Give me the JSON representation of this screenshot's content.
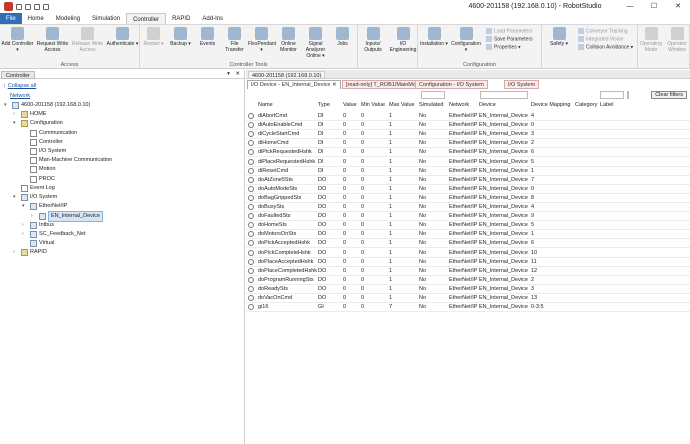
{
  "window": {
    "title": "4600-201158 (192.168.0.10) - RobotStudio",
    "minimize": "—",
    "maximize": "☐",
    "close": "✕"
  },
  "menu": [
    "File",
    "Home",
    "Modeling",
    "Simulation",
    "Controller",
    "RAPID",
    "Add-Ins"
  ],
  "ribbon": {
    "groups": [
      {
        "label": "Access",
        "buttons": [
          "Add Controller ▾",
          "Request Write Access",
          "Release Write Access",
          "Authenticate ▾"
        ]
      },
      {
        "label": "Controller Tools",
        "buttons": [
          "Restart ▾",
          "Backup ▾",
          "Events",
          "File Transfer",
          "FlexPendant ▾",
          "Online Monitor",
          "Signal Analyzer Online ▾",
          "Jobs"
        ]
      },
      {
        "label": "",
        "buttons": [
          "Inputs/ Outputs",
          "I/O Engineering"
        ]
      },
      {
        "label": "Configuration",
        "buttons": [
          "Installation ▾",
          "Configuration ▾"
        ],
        "small": [
          "Load Parameters",
          "Save Parameters",
          "Properties ▾"
        ]
      },
      {
        "label": "",
        "buttons": [
          "Safety ▾"
        ],
        "small": [
          "Conveyor Tracking",
          "Integrated Vision",
          "Collision Avoidance ▾"
        ]
      },
      {
        "label": "",
        "buttons": [
          "Operating Mode",
          "Operator Window"
        ]
      }
    ]
  },
  "controller_panel": {
    "tab": "Controller",
    "collapse": "Collapse all",
    "network": "Network",
    "tree": [
      {
        "label": "4600-201158 (192.168.0.10)",
        "level": 0,
        "exp": "▾",
        "icon": "controller"
      },
      {
        "label": "HOME",
        "level": 1,
        "exp": "›",
        "icon": "folder"
      },
      {
        "label": "Configuration",
        "level": 1,
        "exp": "▾",
        "icon": "folder"
      },
      {
        "label": "Communication",
        "level": 2,
        "exp": "",
        "icon": "doc"
      },
      {
        "label": "Controller",
        "level": 2,
        "exp": "",
        "icon": "doc"
      },
      {
        "label": "I/O System",
        "level": 2,
        "exp": "",
        "icon": "doc"
      },
      {
        "label": "Man-Machine Communication",
        "level": 2,
        "exp": "",
        "icon": "doc"
      },
      {
        "label": "Motion",
        "level": 2,
        "exp": "",
        "icon": "doc"
      },
      {
        "label": "PROC",
        "level": 2,
        "exp": "",
        "icon": "doc"
      },
      {
        "label": "Event Log",
        "level": 1,
        "exp": "",
        "icon": "doc"
      },
      {
        "label": "I/O System",
        "level": 1,
        "exp": "▾",
        "icon": "dev"
      },
      {
        "label": "EtherNet/IP",
        "level": 2,
        "exp": "▾",
        "icon": "dev"
      },
      {
        "label": "EN_Internal_Device",
        "level": 3,
        "exp": "›",
        "icon": "dev",
        "selected": true
      },
      {
        "label": "Intbus",
        "level": 2,
        "exp": "›",
        "icon": "dev"
      },
      {
        "label": "SC_Feedback_Net",
        "level": 2,
        "exp": "›",
        "icon": "dev"
      },
      {
        "label": "Virtual",
        "level": 2,
        "exp": "",
        "icon": "dev"
      },
      {
        "label": "RAPID",
        "level": 1,
        "exp": "›",
        "icon": "folder"
      }
    ]
  },
  "doc": {
    "tab": "4600-201158 (192.168.0.10)",
    "subtabs": [
      "I/O Device - EN_Internal_Device ✕",
      "[read-only] T_ROB1/MainModule",
      "Configuration - I/O System",
      "I/O System"
    ],
    "clear_filters": "Clear filters",
    "columns": [
      "Name",
      "Type",
      "Value",
      "Min Value",
      "Max Value",
      "Simulated",
      "Network",
      "Device",
      "Device Mapping",
      "Category",
      "Label"
    ],
    "rows": [
      [
        "diAbortCmd",
        "DI",
        "0",
        "0",
        "1",
        "No",
        "EtherNet/IP",
        "EN_Internal_Device",
        "4",
        "",
        ""
      ],
      [
        "diAutoEnableCmd",
        "DI",
        "0",
        "0",
        "1",
        "No",
        "EtherNet/IP",
        "EN_Internal_Device",
        "0",
        "",
        ""
      ],
      [
        "diCycleStartCmd",
        "DI",
        "0",
        "0",
        "1",
        "No",
        "EtherNet/IP",
        "EN_Internal_Device",
        "3",
        "",
        ""
      ],
      [
        "diHomeCmd",
        "DI",
        "0",
        "0",
        "1",
        "No",
        "EtherNet/IP",
        "EN_Internal_Device",
        "2",
        "",
        ""
      ],
      [
        "diPickRequestedHshk",
        "DI",
        "0",
        "0",
        "1",
        "No",
        "EtherNet/IP",
        "EN_Internal_Device",
        "6",
        "",
        ""
      ],
      [
        "diPlaceRequestedHshk",
        "DI",
        "0",
        "0",
        "1",
        "No",
        "EtherNet/IP",
        "EN_Internal_Device",
        "5",
        "",
        ""
      ],
      [
        "diResetCmd",
        "DI",
        "0",
        "0",
        "1",
        "No",
        "EtherNet/IP",
        "EN_Internal_Device",
        "1",
        "",
        ""
      ],
      [
        "doAtZone5Sts",
        "DO",
        "0",
        "0",
        "1",
        "No",
        "EtherNet/IP",
        "EN_Internal_Device",
        "7",
        "",
        ""
      ],
      [
        "doAutoModeSts",
        "DO",
        "0",
        "0",
        "1",
        "No",
        "EtherNet/IP",
        "EN_Internal_Device",
        "0",
        "",
        ""
      ],
      [
        "doBagGrippedSts",
        "DO",
        "0",
        "0",
        "1",
        "No",
        "EtherNet/IP",
        "EN_Internal_Device",
        "8",
        "",
        ""
      ],
      [
        "doBusySts",
        "DO",
        "0",
        "0",
        "1",
        "No",
        "EtherNet/IP",
        "EN_Internal_Device",
        "4",
        "",
        ""
      ],
      [
        "doFaultedSts",
        "DO",
        "0",
        "0",
        "1",
        "No",
        "EtherNet/IP",
        "EN_Internal_Device",
        "9",
        "",
        ""
      ],
      [
        "doHomeSts",
        "DO",
        "0",
        "0",
        "1",
        "No",
        "EtherNet/IP",
        "EN_Internal_Device",
        "5",
        "",
        ""
      ],
      [
        "doMotorsOnSts",
        "DO",
        "0",
        "0",
        "1",
        "No",
        "EtherNet/IP",
        "EN_Internal_Device",
        "1",
        "",
        ""
      ],
      [
        "doPickAcceptedHshk",
        "DO",
        "0",
        "0",
        "1",
        "No",
        "EtherNet/IP",
        "EN_Internal_Device",
        "6",
        "",
        ""
      ],
      [
        "doPickCompleteHshk",
        "DO",
        "0",
        "0",
        "1",
        "No",
        "EtherNet/IP",
        "EN_Internal_Device",
        "10",
        "",
        ""
      ],
      [
        "doPlaceAcceptedHshk",
        "DO",
        "0",
        "0",
        "1",
        "No",
        "EtherNet/IP",
        "EN_Internal_Device",
        "11",
        "",
        ""
      ],
      [
        "doPlaceCompletedHshk",
        "DO",
        "0",
        "0",
        "1",
        "No",
        "EtherNet/IP",
        "EN_Internal_Device",
        "12",
        "",
        ""
      ],
      [
        "doProgramRunningSts",
        "DO",
        "0",
        "0",
        "1",
        "No",
        "EtherNet/IP",
        "EN_Internal_Device",
        "2",
        "",
        ""
      ],
      [
        "doReadySts",
        "DO",
        "0",
        "0",
        "1",
        "No",
        "EtherNet/IP",
        "EN_Internal_Device",
        "3",
        "",
        ""
      ],
      [
        "doVacOnCmd",
        "DO",
        "0",
        "0",
        "1",
        "No",
        "EtherNet/IP",
        "EN_Internal_Device",
        "13",
        "",
        ""
      ],
      [
        "gi16",
        "GI",
        "0",
        "0",
        "7",
        "No",
        "EtherNet/IP",
        "EN_Internal_Device",
        "0-3:5",
        "",
        ""
      ]
    ]
  }
}
